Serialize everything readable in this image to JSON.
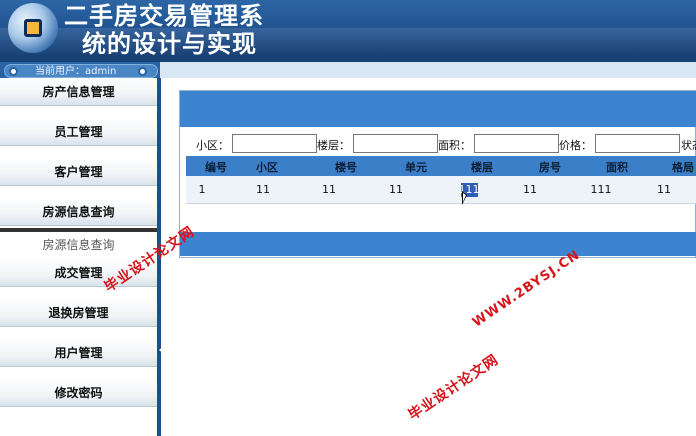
{
  "header": {
    "title_line1": "二手房交易管理系",
    "title_line2": "统的设计与实现"
  },
  "user": {
    "current_user_text": "当前用户：admin"
  },
  "sidebar": {
    "items": [
      {
        "label": "房产信息管理"
      },
      {
        "label": "员工管理"
      },
      {
        "label": "客户管理"
      },
      {
        "label": "房源信息查询"
      },
      {
        "label": "房源信息查询"
      },
      {
        "label": "成交管理"
      },
      {
        "label": "退换房管理"
      },
      {
        "label": "用户管理"
      },
      {
        "label": "修改密码"
      }
    ]
  },
  "search": {
    "community_label": "小区：",
    "floor_label": "楼层：",
    "area_label": "面积：",
    "price_label": "价格：",
    "status_label": "状态"
  },
  "table": {
    "headers": [
      "编号",
      "小区",
      "楼号",
      "单元",
      "楼层",
      "房号",
      "面积",
      "格局"
    ],
    "rows": [
      {
        "cells": [
          "1",
          "11",
          "11",
          "11",
          "111",
          "11",
          "111",
          "11"
        ]
      }
    ]
  },
  "watermark": {
    "text_cn": "毕业设计论文网",
    "text_url": "WWW.2BYSJ.CN"
  },
  "colors": {
    "header_blue": "#1d4f8c",
    "panel_blue": "#3d84d0",
    "watermark_red": "#d8141b"
  }
}
